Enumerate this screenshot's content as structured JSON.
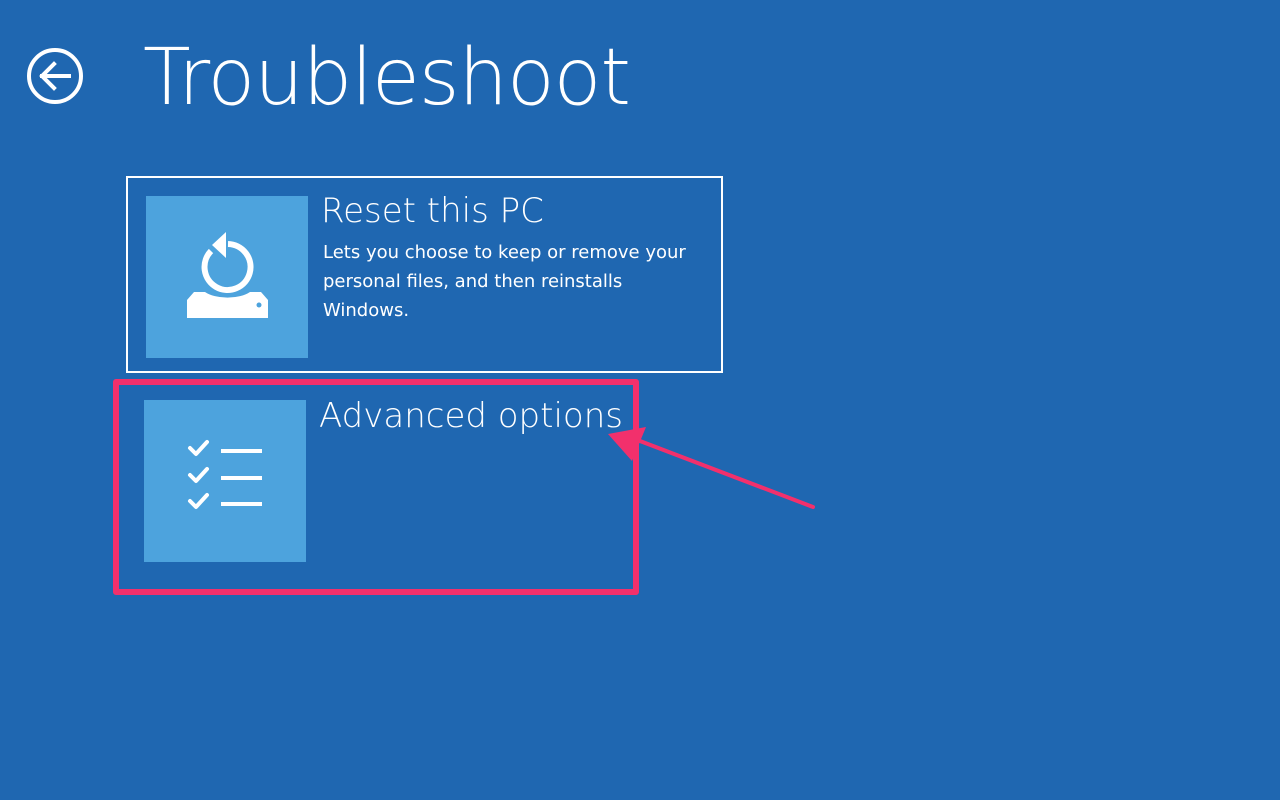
{
  "header": {
    "title": "Troubleshoot",
    "back_icon": "back-arrow-circle-icon"
  },
  "options": [
    {
      "title": "Reset this PC",
      "description": "Lets you choose to keep or remove your personal files, and then reinstalls Windows.",
      "icon": "reset-pc-icon",
      "selected": true
    },
    {
      "title": "Advanced options",
      "description": "",
      "icon": "checklist-icon",
      "selected": false
    }
  ],
  "annotation": {
    "target": "Advanced options",
    "color": "#f2306c"
  },
  "colors": {
    "background": "#1f67b1",
    "tile": "#4da3dd",
    "text": "#ffffff",
    "highlight": "#f2306c"
  }
}
